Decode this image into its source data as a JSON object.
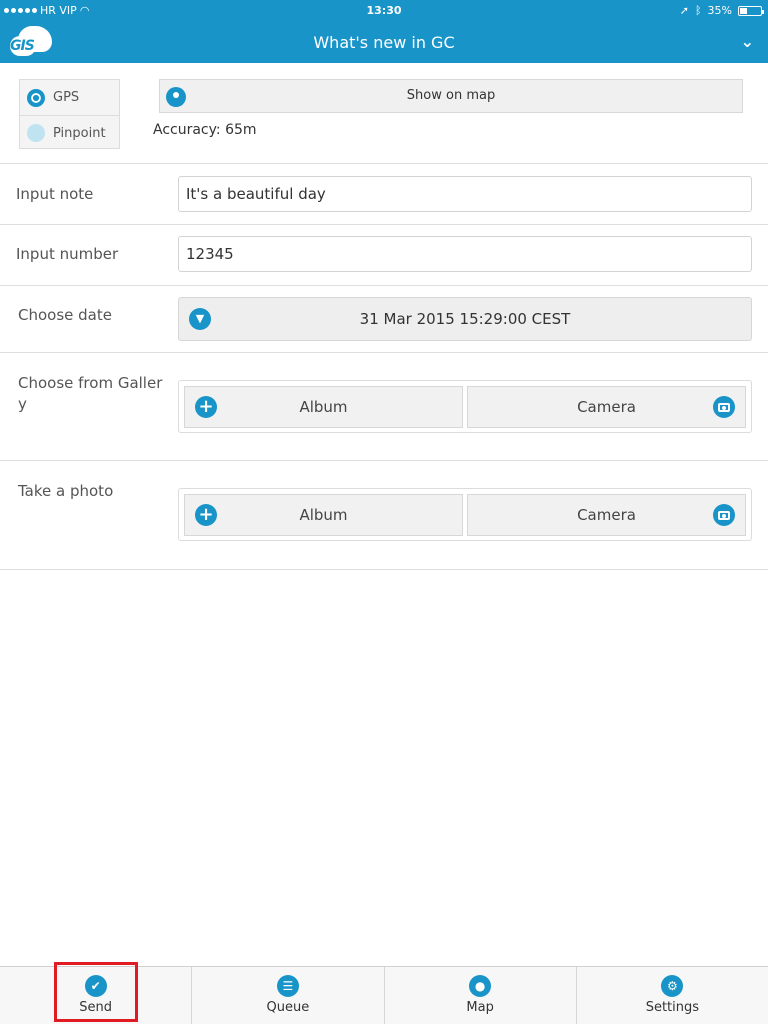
{
  "status_bar": {
    "carrier": "HR VIP",
    "time": "13:30",
    "battery": "35%",
    "battery_level": 0.35
  },
  "header": {
    "logo_text": "GIS",
    "title": "What's new in GC",
    "icons": [
      "logo-cloud",
      "chevron-down-icon"
    ]
  },
  "location": {
    "options": [
      {
        "label": "GPS",
        "selected": true
      },
      {
        "label": "Pinpoint",
        "selected": false
      }
    ],
    "show_map_label": "Show on map",
    "accuracy": "Accuracy: 65m"
  },
  "fields": {
    "input_note": {
      "label": "Input note",
      "value": "It's a beautiful day"
    },
    "input_number": {
      "label": "Input number",
      "value": "12345"
    },
    "choose_date": {
      "label": "Choose date",
      "value": "31 Mar 2015 15:29:00 CEST"
    },
    "gallery": {
      "label": "Choose from Galler y",
      "album": "Album",
      "camera": "Camera"
    },
    "photo": {
      "label": "Take a photo",
      "album": "Album",
      "camera": "Camera"
    }
  },
  "tabbar": {
    "items": [
      {
        "label": "Send",
        "icon": "check-icon",
        "highlighted": true
      },
      {
        "label": "Queue",
        "icon": "list-icon"
      },
      {
        "label": "Map",
        "icon": "map-pin-icon"
      },
      {
        "label": "Settings",
        "icon": "gear-icon"
      }
    ]
  },
  "colors": {
    "accent": "#1994c9",
    "highlight": "#e01c22"
  }
}
